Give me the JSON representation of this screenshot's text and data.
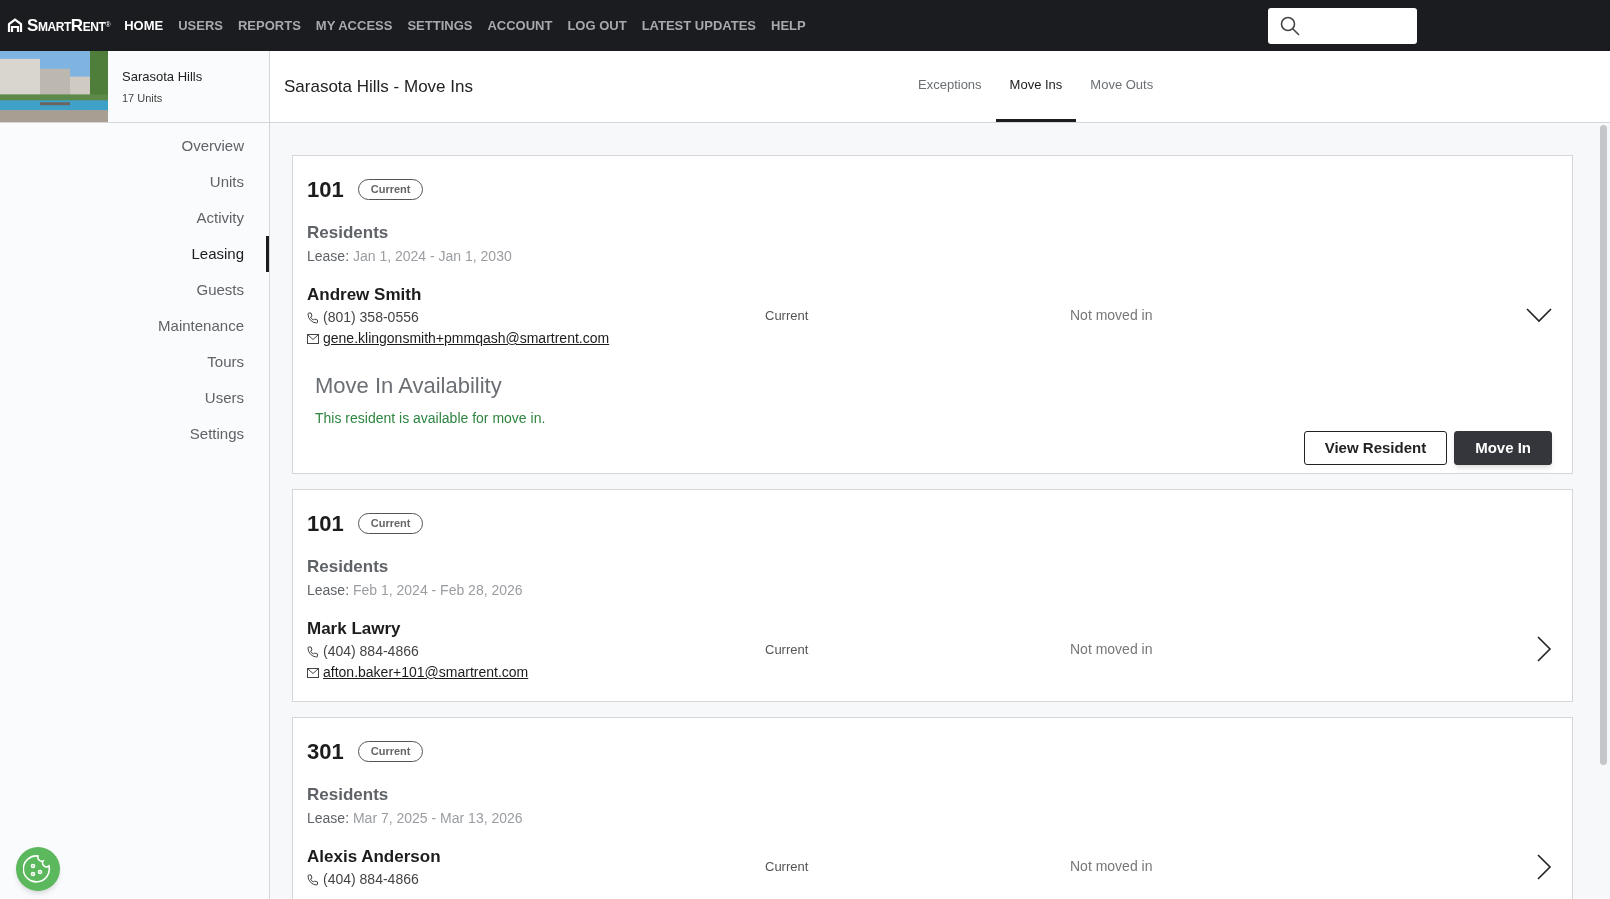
{
  "topnav": {
    "logo": "SmartRent",
    "logo_mark": "®",
    "items": [
      {
        "label": "HOME",
        "selected": true
      },
      {
        "label": "USERS",
        "selected": false
      },
      {
        "label": "REPORTS",
        "selected": false
      },
      {
        "label": "MY ACCESS",
        "selected": false
      },
      {
        "label": "SETTINGS",
        "selected": false
      },
      {
        "label": "ACCOUNT",
        "selected": false
      },
      {
        "label": "LOG OUT",
        "selected": false
      },
      {
        "label": "LATEST UPDATES",
        "selected": false
      },
      {
        "label": "HELP",
        "selected": false
      }
    ]
  },
  "property": {
    "name": "Sarasota Hills",
    "units": "17 Units"
  },
  "sidebar": {
    "items": [
      {
        "label": "Overview",
        "selected": false
      },
      {
        "label": "Units",
        "selected": false
      },
      {
        "label": "Activity",
        "selected": false
      },
      {
        "label": "Leasing",
        "selected": true
      },
      {
        "label": "Guests",
        "selected": false
      },
      {
        "label": "Maintenance",
        "selected": false
      },
      {
        "label": "Tours",
        "selected": false
      },
      {
        "label": "Users",
        "selected": false
      },
      {
        "label": "Settings",
        "selected": false
      }
    ]
  },
  "page": {
    "title": "Sarasota Hills - Move Ins",
    "tabs": [
      {
        "label": "Exceptions",
        "selected": false
      },
      {
        "label": "Move Ins",
        "selected": true
      },
      {
        "label": "Move Outs",
        "selected": false
      }
    ]
  },
  "cards": [
    {
      "unit": "101",
      "badge": "Current",
      "residents_label": "Residents",
      "lease_label": "Lease:",
      "lease_dates": "Jan 1, 2024 - Jan 1, 2030",
      "expanded": true,
      "resident": {
        "name": "Andrew Smith",
        "phone": "(801) 358-0556",
        "email": "gene.klingonsmith+pmmqash@smartrent.com",
        "status": "Current",
        "move_status": "Not moved in"
      },
      "availability": {
        "title": "Move In Availability",
        "message": "This resident is available for move in."
      },
      "buttons": [
        {
          "label": "View Resident",
          "kind": "outline"
        },
        {
          "label": "Move In",
          "kind": "primary"
        }
      ]
    },
    {
      "unit": "101",
      "badge": "Current",
      "residents_label": "Residents",
      "lease_label": "Lease:",
      "lease_dates": "Feb 1, 2024 - Feb 28, 2026",
      "expanded": false,
      "resident": {
        "name": "Mark Lawry",
        "phone": "(404) 884-4866",
        "email": "afton.baker+101@smartrent.com",
        "status": "Current",
        "move_status": "Not moved in"
      }
    },
    {
      "unit": "301",
      "badge": "Current",
      "residents_label": "Residents",
      "lease_label": "Lease:",
      "lease_dates": "Mar 7, 2025 - Mar 13, 2026",
      "expanded": false,
      "resident": {
        "name": "Alexis Anderson",
        "phone": "(404) 884-4866",
        "status": "Current",
        "move_status": "Not moved in"
      }
    }
  ]
}
